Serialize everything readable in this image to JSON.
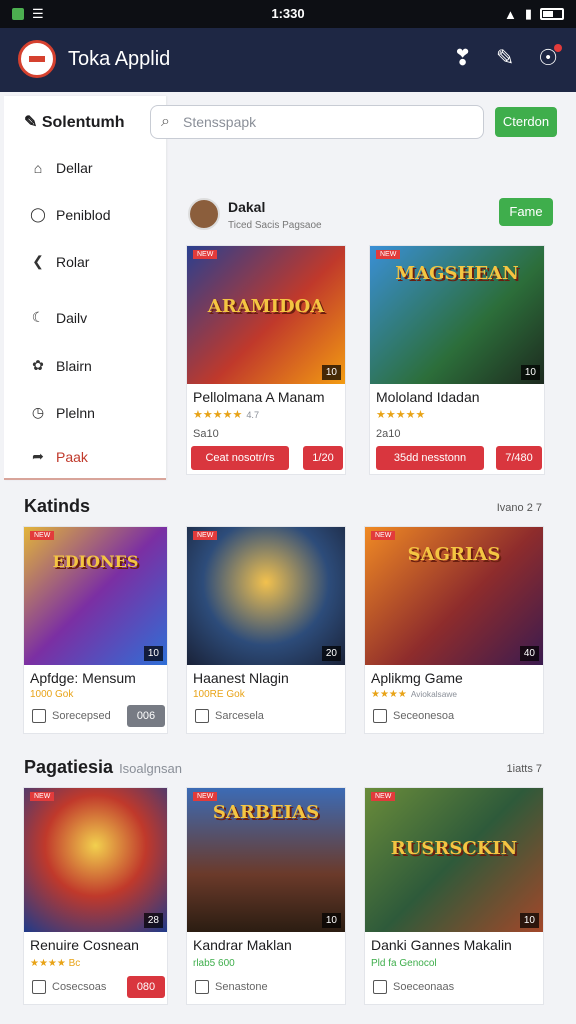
{
  "status": {
    "time": "1:330"
  },
  "app": {
    "title": "Toka Applid"
  },
  "sidebar": {
    "header": "Solentumh",
    "items": [
      {
        "label": "Dellar",
        "icon": "house-icon"
      },
      {
        "label": "Peniblod",
        "icon": "circle-icon"
      },
      {
        "label": "Rolar",
        "icon": "share-icon"
      },
      {
        "label": "Dailv",
        "icon": "moon-icon"
      },
      {
        "label": "Blairn",
        "icon": "leaf-icon"
      },
      {
        "label": "Plelnn",
        "icon": "clock-icon"
      },
      {
        "label": "Paak",
        "icon": "tag-icon",
        "active": true
      }
    ]
  },
  "search": {
    "placeholder": "Stensspapk",
    "button": "Cterdon"
  },
  "profile": {
    "name": "Dakal",
    "sub": "Ticed Sacis Pagsaoe",
    "button": "Fame"
  },
  "featured": [
    {
      "image_title": "ARAMIDOA",
      "badge": "NEW",
      "num": "10",
      "title": "Pellolmana A Manam",
      "stars": "★★★★★",
      "rating": "4.7",
      "price": "Sa10",
      "btn1": "Ceat nosotr/rs",
      "btn2": "1/20"
    },
    {
      "image_title": "MAGSHEAN",
      "badge": "NEW",
      "num": "10",
      "title": "Mololand Idadan",
      "stars": "★★★★★",
      "price": "2a10",
      "btn1": "35dd nesstonn",
      "btn2": "7/480"
    }
  ],
  "sections": [
    {
      "title": "Katinds",
      "subtitle": "",
      "more": "Ivano 2 7",
      "cards": [
        {
          "image_title": "EDIONES",
          "badge": "NEW",
          "num": "10",
          "title": "Apfdge: Mensum",
          "rating_text": "1000 Gok",
          "foot": "Sorecepsed",
          "pill": "006",
          "pill_color": "#777b84"
        },
        {
          "image_title": "",
          "badge": "NEW",
          "num": "20",
          "title": "Haanest Nlagin",
          "rating_text": "100RE Gok",
          "foot": "Sarcesela",
          "pill": "",
          "pill_color": ""
        },
        {
          "image_title": "SAGRIAS",
          "badge": "NEW",
          "num": "40",
          "title": "Aplikmg Game",
          "rating_text": "★★★★",
          "rating_sub": "Aviokalsawe",
          "foot": "Seceonesoa",
          "pill": "",
          "pill_color": ""
        }
      ]
    },
    {
      "title": "Pagatiesia",
      "subtitle": "Isoalgnsan",
      "more": "1iatts 7",
      "cards": [
        {
          "image_title": "",
          "badge": "NEW",
          "num": "28",
          "title": "Renuire Cosnean",
          "rating_text": "★★★★ Bc",
          "foot": "Cosecsoas",
          "pill": "080",
          "pill_color": "#d9363e"
        },
        {
          "image_title": "SARBEIAS",
          "badge": "NEW",
          "num": "10",
          "title": "Kandrar Maklan",
          "rating_text": "rlab5 600",
          "foot": "Senastone",
          "pill": "",
          "pill_color": ""
        },
        {
          "image_title": "RUSRSCKIN",
          "badge": "NEW",
          "num": "10",
          "title": "Danki Gannes Makalin",
          "rating_text": "Pld fa Genocol",
          "foot": "Soeceonaas",
          "pill": "",
          "pill_color": ""
        }
      ]
    }
  ]
}
